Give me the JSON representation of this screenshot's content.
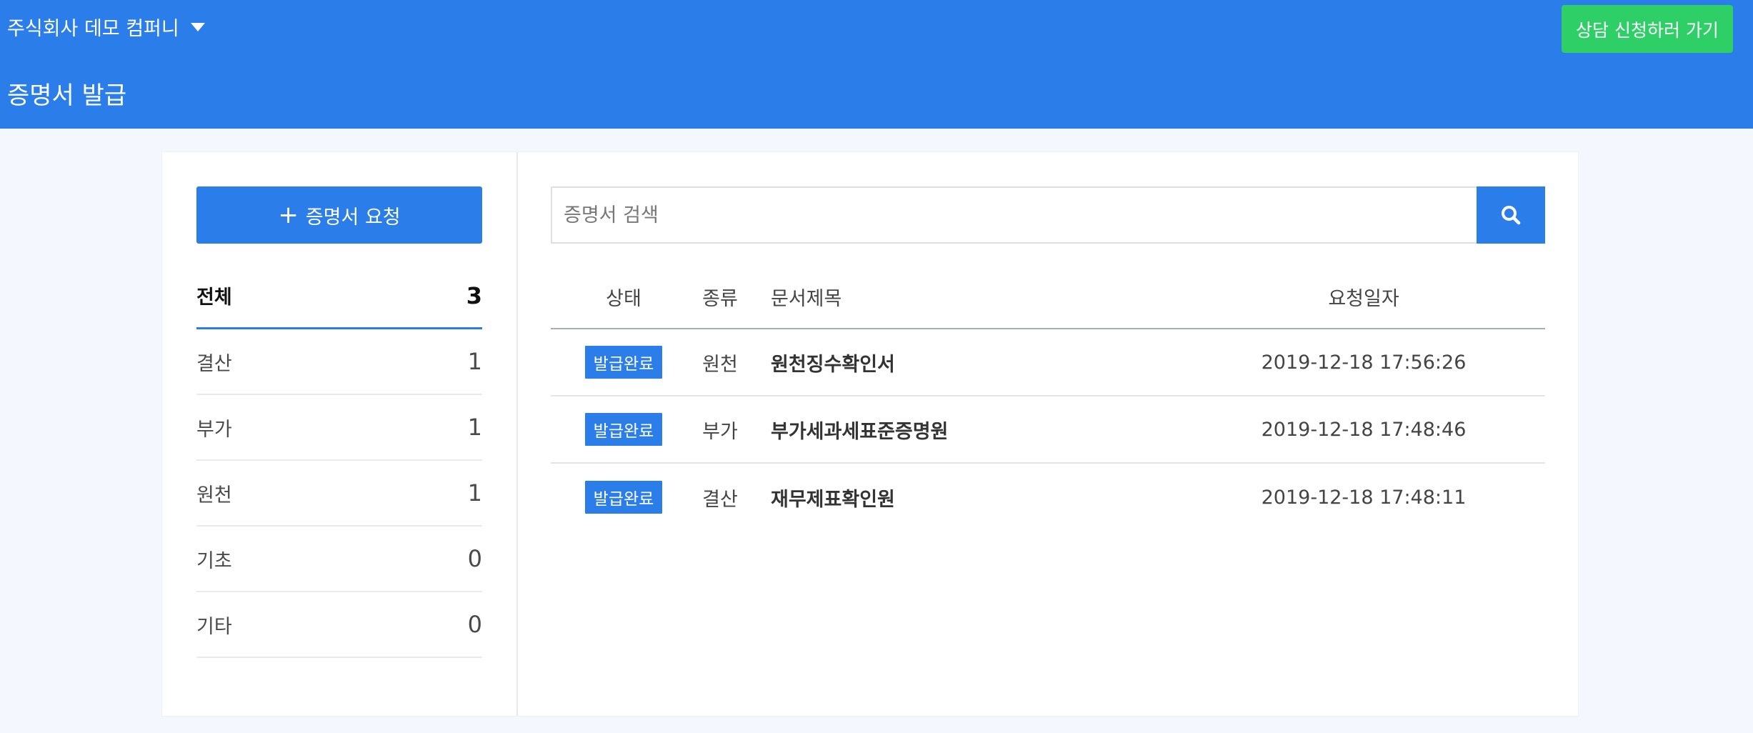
{
  "header": {
    "company_name": "주식회사 데모 컴퍼니",
    "consult_button": "상담 신청하러 가기",
    "page_title": "증명서 발급"
  },
  "sidebar": {
    "add_button_label": "증명서 요청",
    "categories": [
      {
        "label": "전체",
        "count": "3"
      },
      {
        "label": "결산",
        "count": "1"
      },
      {
        "label": "부가",
        "count": "1"
      },
      {
        "label": "원천",
        "count": "1"
      },
      {
        "label": "기초",
        "count": "0"
      },
      {
        "label": "기타",
        "count": "0"
      }
    ]
  },
  "search": {
    "placeholder": "증명서 검색",
    "value": ""
  },
  "table": {
    "headers": {
      "status": "상태",
      "type": "종류",
      "title": "문서제목",
      "date": "요청일자"
    },
    "rows": [
      {
        "status": "발급완료",
        "type": "원천",
        "title": "원천징수확인서",
        "date": "2019-12-18 17:56:26"
      },
      {
        "status": "발급완료",
        "type": "부가",
        "title": "부가세과세표준증명원",
        "date": "2019-12-18 17:48:46"
      },
      {
        "status": "발급완료",
        "type": "결산",
        "title": "재무제표확인원",
        "date": "2019-12-18 17:48:11"
      }
    ]
  },
  "colors": {
    "primary": "#2b7de9",
    "accent_green": "#2fcf68",
    "background": "#f4f7fd"
  },
  "icons": {
    "company_dropdown": "caret-down-icon",
    "add": "plus-icon",
    "search": "search-icon"
  }
}
